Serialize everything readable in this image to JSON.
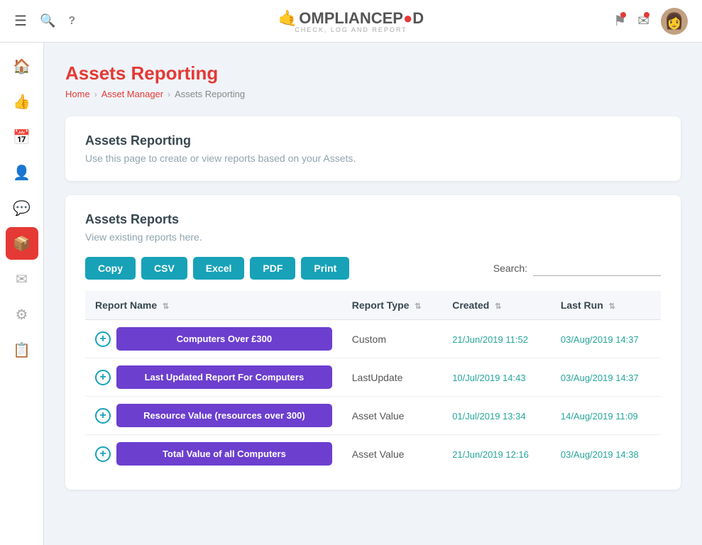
{
  "app": {
    "name": "Compliance Pod",
    "tagline": "CHECK, LOG AND REPORT"
  },
  "header": {
    "hamburger_icon": "☰",
    "search_icon": "🔍",
    "help_icon": "?",
    "flag_icon": "⚑",
    "mail_icon": "✉"
  },
  "breadcrumb": {
    "home": "Home",
    "asset_manager": "Asset Manager",
    "current": "Assets Reporting"
  },
  "page_title": "Assets Reporting",
  "info_card": {
    "title": "Assets Reporting",
    "subtitle": "Use this page to create or view reports based on your Assets."
  },
  "reports_card": {
    "title": "Assets Reports",
    "subtitle": "View existing reports here.",
    "buttons": {
      "copy": "Copy",
      "csv": "CSV",
      "excel": "Excel",
      "pdf": "PDF",
      "print": "Print"
    },
    "search_label": "Search:",
    "search_placeholder": "",
    "table": {
      "headers": [
        {
          "label": "Report Name",
          "key": "report_name"
        },
        {
          "label": "Report Type",
          "key": "report_type"
        },
        {
          "label": "Created",
          "key": "created"
        },
        {
          "label": "Last Run",
          "key": "last_run"
        }
      ],
      "rows": [
        {
          "id": 1,
          "report_name": "Computers Over £300",
          "report_type": "Custom",
          "created": "21/Jun/2019 11:52",
          "last_run": "03/Aug/2019 14:37"
        },
        {
          "id": 2,
          "report_name": "Last Updated Report For Computers",
          "report_type": "LastUpdate",
          "created": "10/Jul/2019 14:43",
          "last_run": "03/Aug/2019 14:37"
        },
        {
          "id": 3,
          "report_name": "Resource Value (resources over 300)",
          "report_type": "Asset Value",
          "created": "01/Jul/2019 13:34",
          "last_run": "14/Aug/2019 11:09"
        },
        {
          "id": 4,
          "report_name": "Total Value of all Computers",
          "report_type": "Asset Value",
          "created": "21/Jun/2019 12:16",
          "last_run": "03/Aug/2019 14:38"
        }
      ]
    }
  },
  "sidebar": {
    "items": [
      {
        "icon": "🏠",
        "label": "Home",
        "active": false
      },
      {
        "icon": "👍",
        "label": "Like",
        "active": false
      },
      {
        "icon": "📅",
        "label": "Calendar",
        "active": false
      },
      {
        "icon": "👤",
        "label": "Users",
        "active": false
      },
      {
        "icon": "💬",
        "label": "Messages",
        "active": false
      },
      {
        "icon": "📦",
        "label": "Assets",
        "active": true
      },
      {
        "icon": "✉",
        "label": "Mail",
        "active": false
      },
      {
        "icon": "⚙",
        "label": "Settings",
        "active": false
      },
      {
        "icon": "📋",
        "label": "Reports",
        "active": false
      }
    ]
  }
}
